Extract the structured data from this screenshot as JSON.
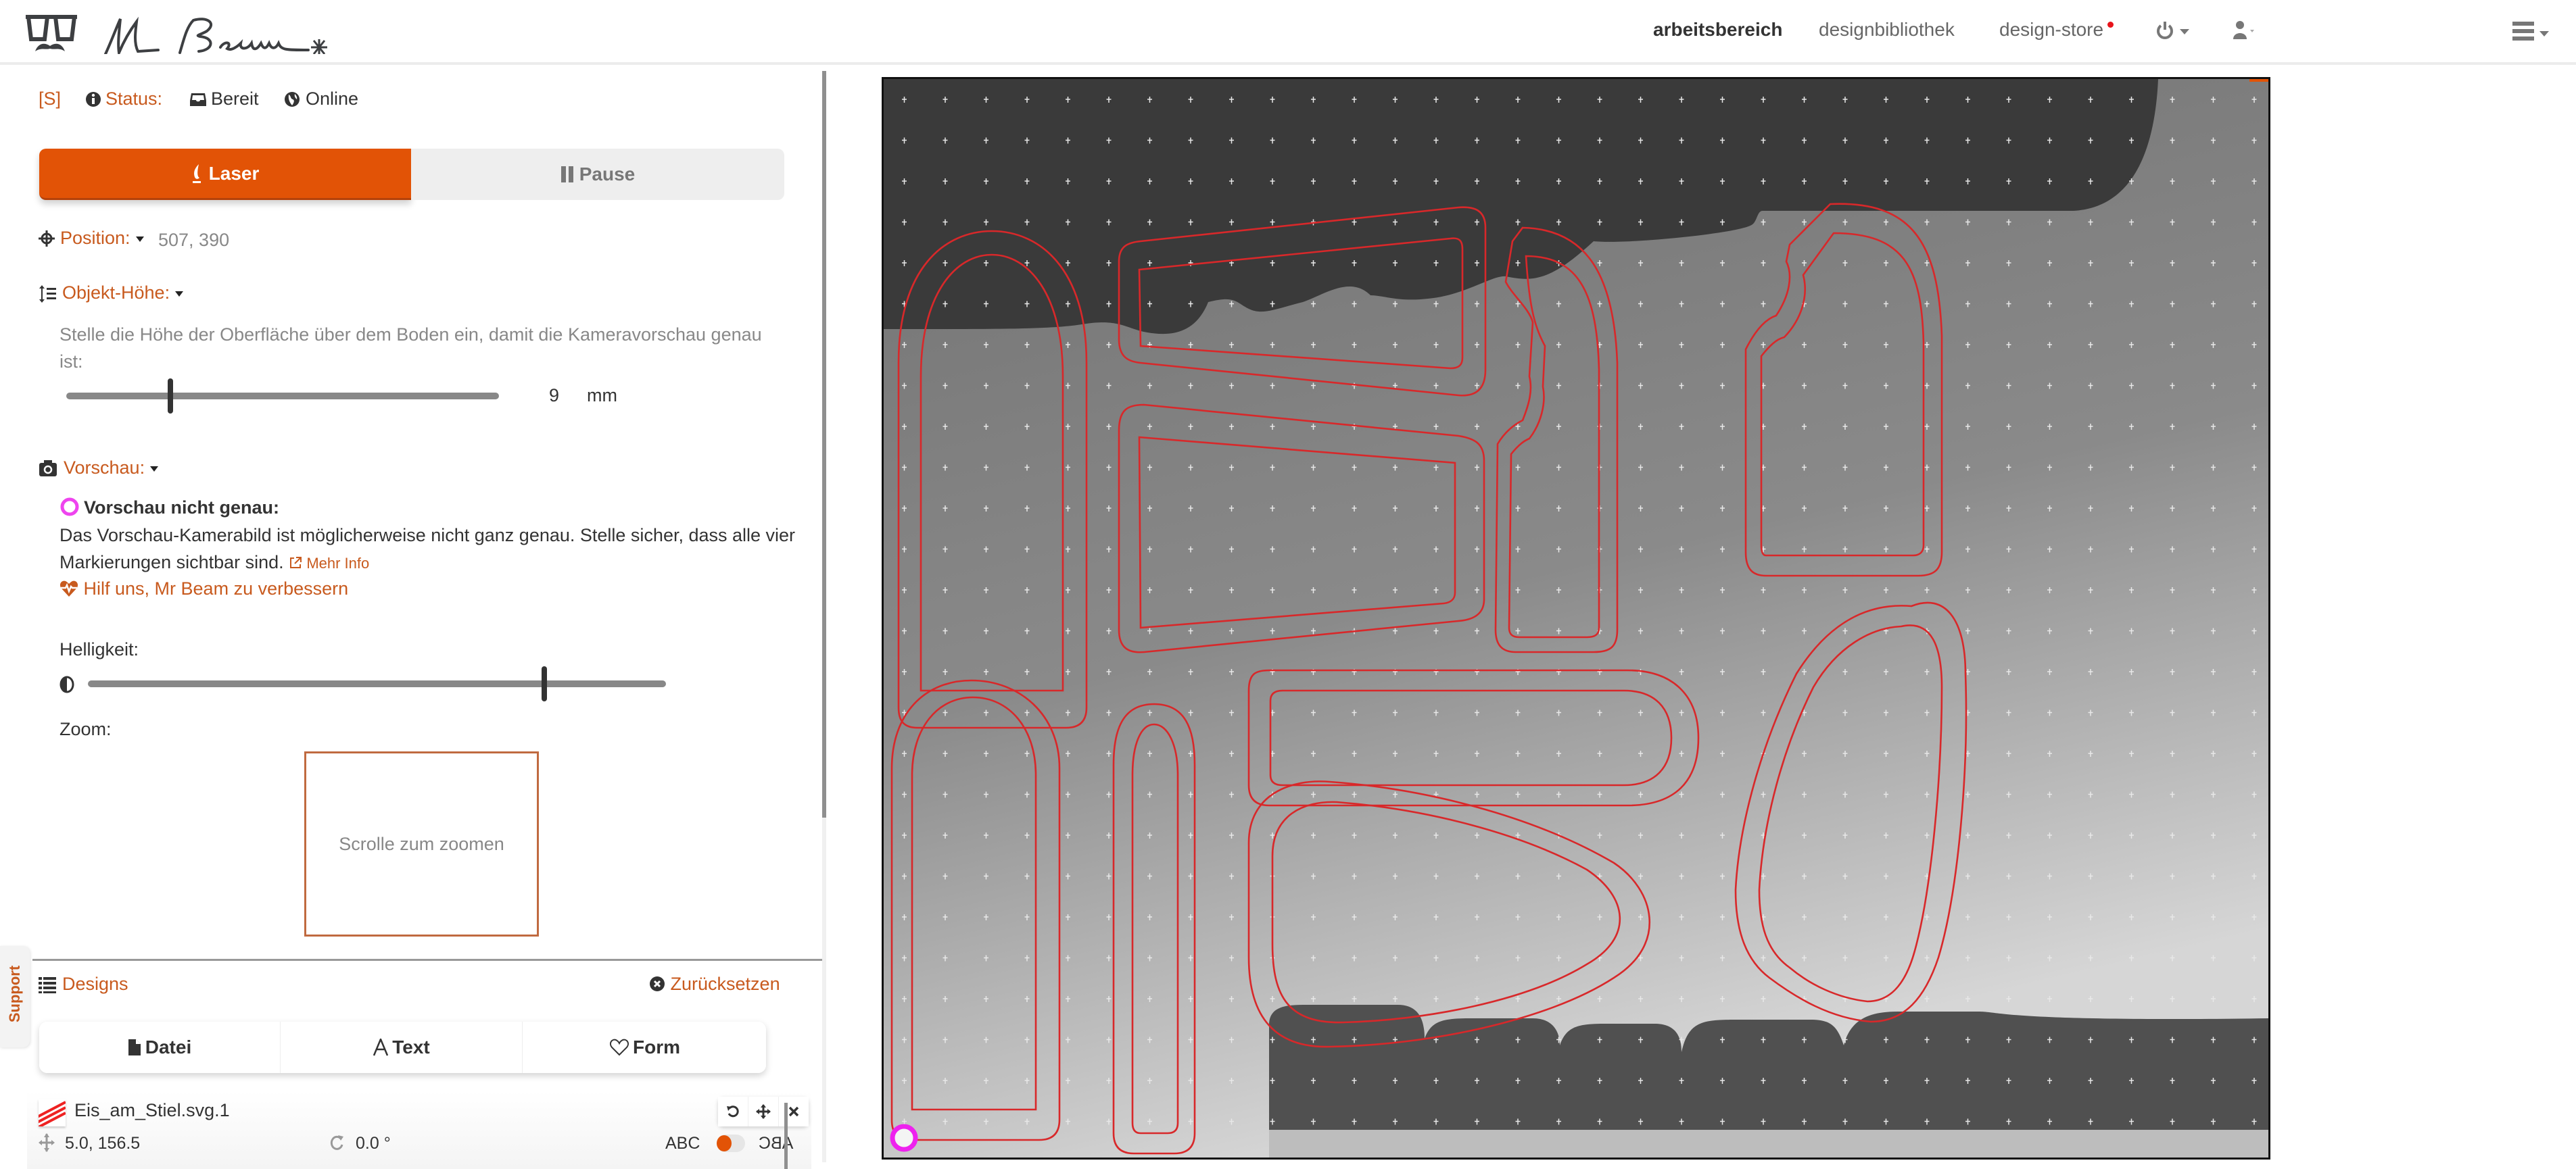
{
  "header": {
    "brand": "Mr Beam",
    "nav": [
      {
        "label": "arbeitsbereich",
        "active": true
      },
      {
        "label": "designbibliothek",
        "active": false
      },
      {
        "label": "design-store",
        "active": false,
        "notification": true
      }
    ],
    "icons": [
      "power-icon",
      "user-icon",
      "hamburger-menu-icon"
    ]
  },
  "status": {
    "shortcut": "[S]",
    "label": "Status:",
    "state": "Bereit",
    "connection": "Online"
  },
  "mode_buttons": {
    "laser": "Laser",
    "pause": "Pause",
    "active": "laser"
  },
  "position": {
    "label": "Position:",
    "value": "507, 390"
  },
  "object_height": {
    "label": "Objekt-Höhe:",
    "description": "Stelle die Höhe der Oberfläche über dem Boden ein, damit die Kameravorschau genau ist:",
    "value": "9",
    "unit": "mm",
    "slider_fraction": 0.24
  },
  "preview": {
    "label": "Vorschau:",
    "warning_title": "Vorschau nicht genau:",
    "warning_text": "Das Vorschau-Kamerabild ist möglicherweise nicht ganz genau. Stelle sicher, dass alle vier Markierungen sichtbar sind.",
    "more_info": "Mehr Info",
    "help_link": "Hilf uns, Mr Beam zu verbessern",
    "brightness_label": "Helligkeit:",
    "brightness_fraction": 0.79,
    "zoom_label": "Zoom:",
    "zoom_hint": "Scrolle zum zoomen"
  },
  "support_tab": "Support",
  "designs": {
    "title": "Designs",
    "reset": "Zurücksetzen",
    "add_buttons": [
      {
        "label": "Datei",
        "icon": "file-icon"
      },
      {
        "label": "Text",
        "icon": "font-icon"
      },
      {
        "label": "Form",
        "icon": "heart-icon"
      }
    ],
    "items": [
      {
        "name": "Eis_am_Stiel.svg.1",
        "position": "5.0, 156.5",
        "rotation": "0.0 °",
        "mirror_left": "ABC",
        "mirror_right": "ABC",
        "mirror_on": false
      }
    ]
  },
  "colors": {
    "accent": "#e25306",
    "link": "#c85a1e",
    "design_stroke": "#d8282a",
    "marker": "#ee22ee"
  }
}
